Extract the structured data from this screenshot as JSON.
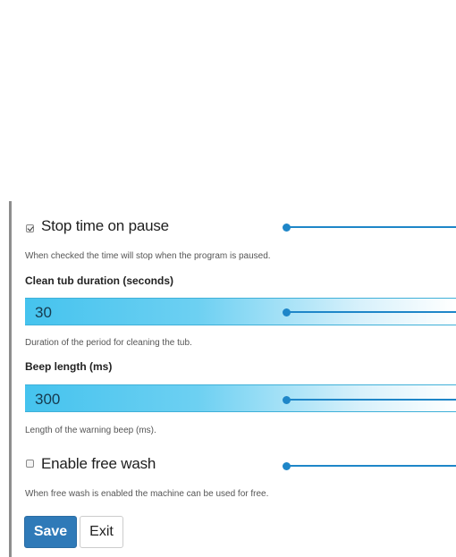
{
  "settings": {
    "stop_time_on_pause": {
      "label": "Stop time on pause",
      "checked": true,
      "help": "When checked the time will stop when the program is paused."
    },
    "clean_tub_duration": {
      "label": "Clean tub duration (seconds)",
      "value": "30",
      "help": "Duration of the period for cleaning the tub."
    },
    "beep_length": {
      "label": "Beep length (ms)",
      "value": "300",
      "help": "Length of the warning beep (ms)."
    },
    "enable_free_wash": {
      "label": "Enable free wash",
      "checked": false,
      "help": "When free wash is enabled the machine can be used for free."
    }
  },
  "actions": {
    "save_label": "Save",
    "exit_label": "Exit"
  },
  "colors": {
    "accent": "#1e86c8",
    "input_fill": "#45c3ee",
    "save_button": "#2f7ab8"
  }
}
